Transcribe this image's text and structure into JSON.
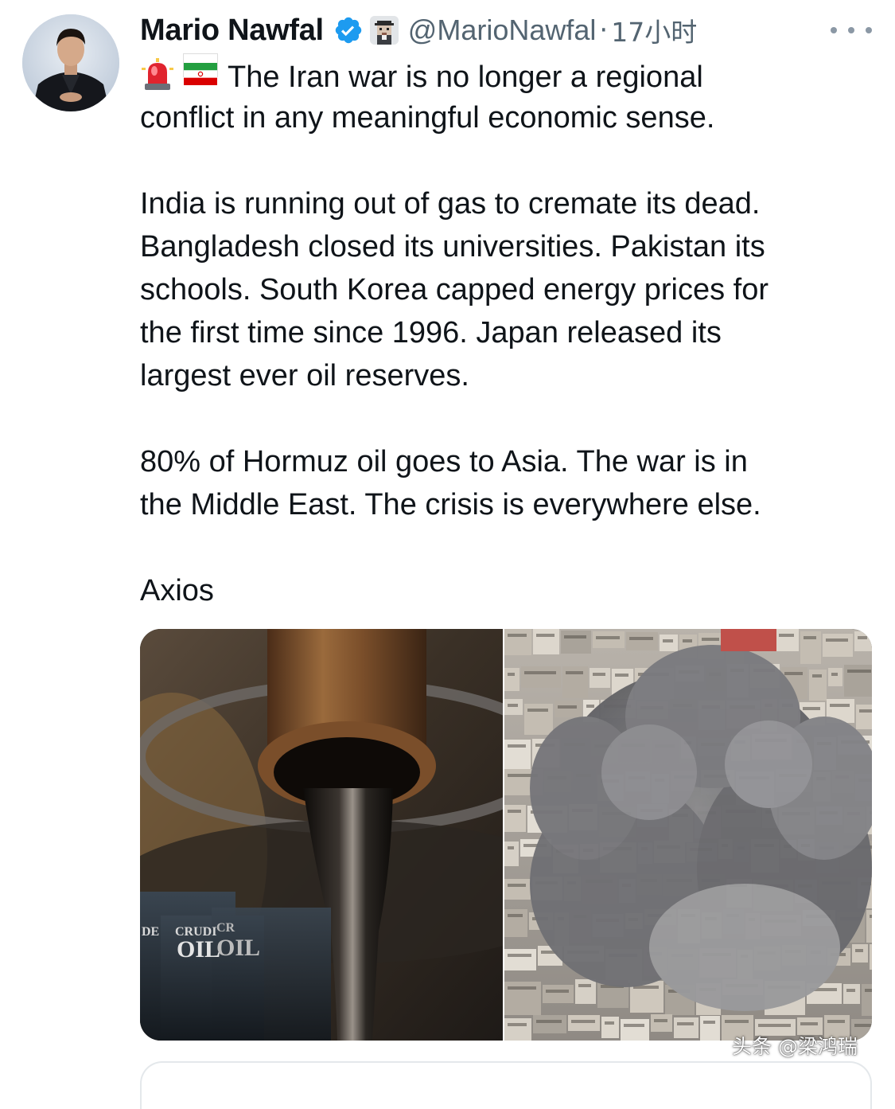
{
  "tweet": {
    "author": {
      "display_name": "Mario Nawfal",
      "handle": "@MarioNawfal",
      "verified": true,
      "verified_color": "#1d9bf0"
    },
    "separator": "·",
    "time_ago": "17小时",
    "body": {
      "emoji": [
        "siren-emoji",
        "iran-flag-emoji"
      ],
      "lines_p1": [
        "The Iran war is no longer a regional",
        "conflict in any meaningful economic sense."
      ],
      "lines_p2": [
        "India is running out of gas to cremate its dead.",
        "Bangladesh closed its universities. Pakistan its",
        "schools. South Korea capped energy prices for",
        "the first time since 1996. Japan released its",
        "largest ever oil reserves."
      ],
      "lines_p3": [
        "80% of Hormuz oil goes to Asia. The war is in",
        "the Middle East. The crisis is everywhere else."
      ],
      "source": "Axios"
    },
    "media": {
      "left_image": {
        "content": "oil-pouring-from-pipe",
        "barrel_label_1": "DE",
        "barrel_label_2": "CRUDI",
        "barrel_label_3": "CR",
        "barrel_label_4": "OIL",
        "barrel_label_5": "OIL"
      },
      "right_image": {
        "content": "smoke-cloud-over-city"
      }
    },
    "watermark": "头条 @梁鸿瑞"
  },
  "colors": {
    "text_primary": "#0f1419",
    "text_secondary": "#536471",
    "accent": "#1d9bf0"
  }
}
